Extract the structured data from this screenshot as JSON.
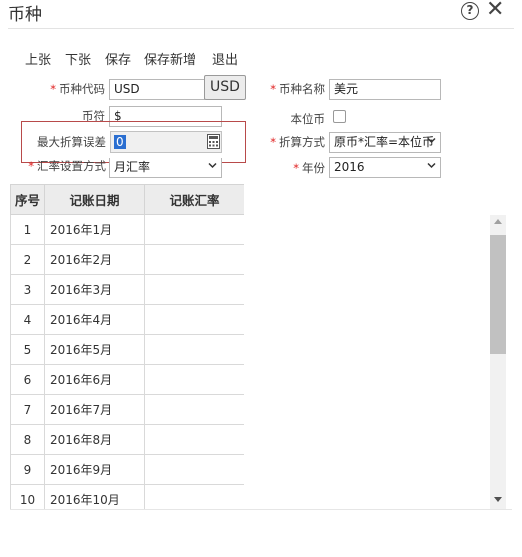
{
  "window": {
    "title": "币种",
    "help_icon": "help-icon",
    "close_icon": "close-icon"
  },
  "toolbar": {
    "items": [
      {
        "label": "上张"
      },
      {
        "label": "下张"
      },
      {
        "label": "保存"
      },
      {
        "label": "保存新增"
      },
      {
        "label": "退出"
      }
    ]
  },
  "form": {
    "currency_code": {
      "label": "币种代码",
      "required": "*",
      "value": "USD",
      "button_label": "USD"
    },
    "currency_name": {
      "label": "币种名称",
      "required": "*",
      "value": "美元"
    },
    "symbol": {
      "label": "币符",
      "value": "$"
    },
    "base_currency": {
      "label": "本位币",
      "checked": false
    },
    "max_error": {
      "label": "最大折算误差",
      "value": "0",
      "icon": "calculator-icon"
    },
    "convert_method": {
      "label": "折算方式",
      "required": "*",
      "value": "原币*汇率=本位币"
    },
    "rate_setting": {
      "label": "汇率设置方式",
      "required": "*",
      "value": "月汇率"
    },
    "year": {
      "label": "年份",
      "required": "*",
      "value": "2016"
    }
  },
  "grid": {
    "columns": [
      "序号",
      "记账日期",
      "记账汇率"
    ],
    "rows": [
      {
        "no": "1",
        "date": "2016年1月",
        "rate": ""
      },
      {
        "no": "2",
        "date": "2016年2月",
        "rate": ""
      },
      {
        "no": "3",
        "date": "2016年3月",
        "rate": ""
      },
      {
        "no": "4",
        "date": "2016年4月",
        "rate": ""
      },
      {
        "no": "5",
        "date": "2016年5月",
        "rate": ""
      },
      {
        "no": "6",
        "date": "2016年6月",
        "rate": ""
      },
      {
        "no": "7",
        "date": "2016年7月",
        "rate": ""
      },
      {
        "no": "8",
        "date": "2016年8月",
        "rate": ""
      },
      {
        "no": "9",
        "date": "2016年9月",
        "rate": ""
      },
      {
        "no": "10",
        "date": "2016年10月",
        "rate": ""
      }
    ]
  },
  "colors": {
    "required": "#e02020",
    "highlight": "#b84a4a",
    "selection": "#2b6fd1"
  }
}
